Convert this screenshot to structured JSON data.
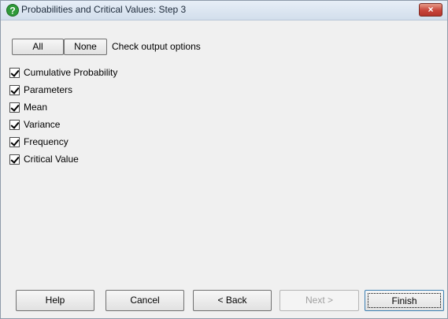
{
  "window": {
    "title": "Probabilities and Critical Values: Step 3",
    "close_label": "×"
  },
  "toolbar": {
    "all_label": "All",
    "none_label": "None",
    "instruction": "Check output options"
  },
  "options": [
    {
      "label": "Cumulative Probability",
      "checked": true
    },
    {
      "label": "Parameters",
      "checked": true
    },
    {
      "label": "Mean",
      "checked": true
    },
    {
      "label": "Variance",
      "checked": true
    },
    {
      "label": "Frequency",
      "checked": true
    },
    {
      "label": "Critical Value",
      "checked": true
    }
  ],
  "buttons": {
    "help": "Help",
    "cancel": "Cancel",
    "back": "< Back",
    "next": "Next >",
    "finish": "Finish"
  },
  "icons": {
    "title_icon": "help-question-icon",
    "check": "checkmark-icon"
  },
  "colors": {
    "title_icon": "#2f9a3a",
    "close_button": "#c7443a"
  }
}
